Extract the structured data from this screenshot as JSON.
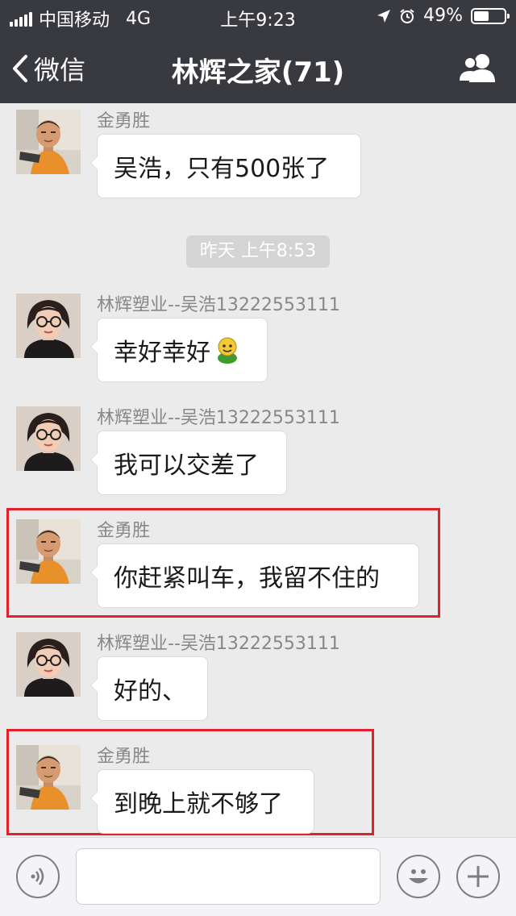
{
  "status_bar": {
    "carrier": "中国移动",
    "network": "4G",
    "time": "上午9:23",
    "battery_percent": "49%",
    "battery_level": 0.49
  },
  "nav": {
    "back_label": "微信",
    "title": "林辉之家(71)"
  },
  "messages": [
    {
      "sender": "金勇胜",
      "text": "吴浩，只有500张了",
      "avatar": "man"
    },
    {
      "sender": "林辉塑业--吴浩13222553111",
      "text": "幸好幸好",
      "avatar": "woman",
      "emoji": "green-face-emoji"
    },
    {
      "sender": "林辉塑业--吴浩13222553111",
      "text": "我可以交差了",
      "avatar": "woman"
    },
    {
      "sender": "金勇胜",
      "text": "你赶紧叫车，我留不住的",
      "avatar": "man",
      "highlighted": true
    },
    {
      "sender": "林辉塑业--吴浩13222553111",
      "text": "好的、",
      "avatar": "woman"
    },
    {
      "sender": "金勇胜",
      "text": "到晚上就不够了",
      "avatar": "man",
      "highlighted": true
    }
  ],
  "timestamp": "昨天 上午8:53",
  "input": {
    "placeholder": "",
    "value": ""
  },
  "colors": {
    "header_bg": "#393a3f",
    "chat_bg": "#ebebeb",
    "highlight": "#e0212b"
  },
  "icons": {
    "voice": "voice-icon",
    "emoji": "emoji-icon",
    "plus": "plus-icon",
    "members": "group-members-icon",
    "back": "back-chevron-icon"
  }
}
